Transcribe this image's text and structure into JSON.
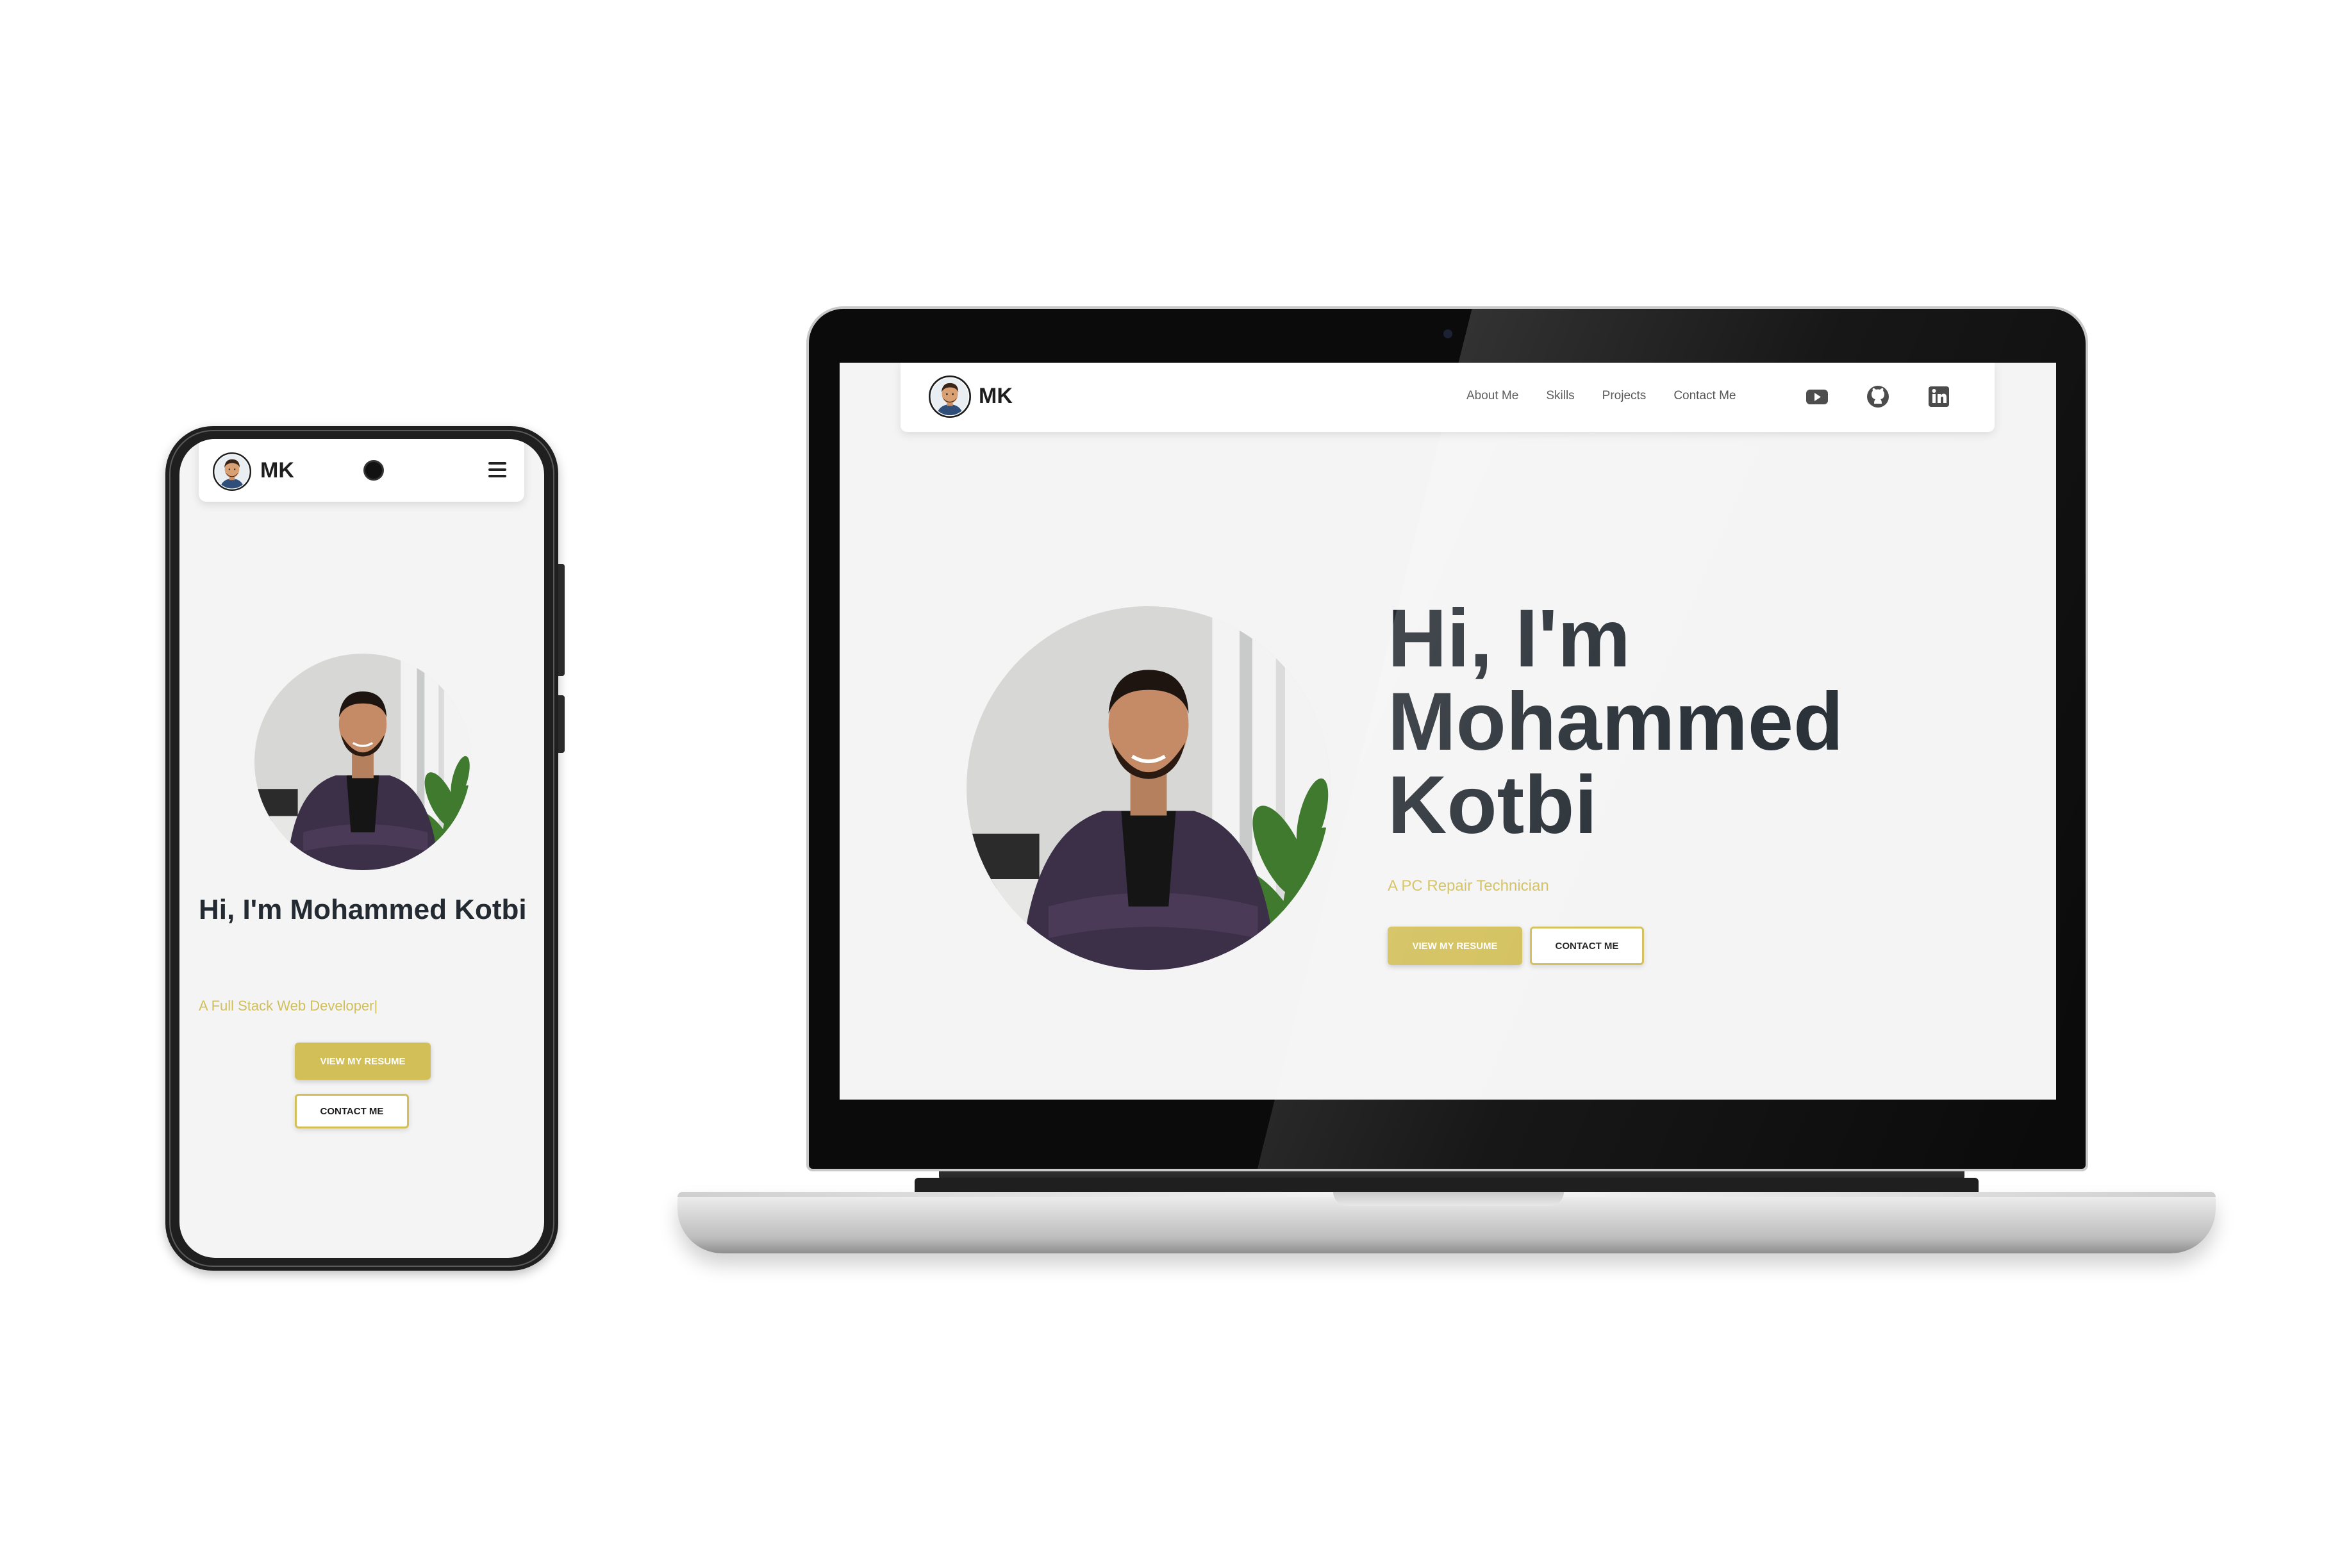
{
  "phone": {
    "logo": "MK",
    "heading": "Hi, I'm Mohammed Kotbi",
    "subtitle": "A Full Stack Web Developer|",
    "resume_btn": "VIEW MY RESUME",
    "contact_btn": "CONTACT ME"
  },
  "laptop": {
    "logo": "MK",
    "nav": [
      "About Me",
      "Skills",
      "Projects",
      "Contact Me"
    ],
    "social_icons": [
      "youtube-icon",
      "github-icon",
      "linkedin-icon"
    ],
    "heading_lines": [
      "Hi, I'm",
      "Mohammed",
      "Kotbi"
    ],
    "subtitle": "A PC Repair Technician",
    "resume_btn": "VIEW MY RESUME",
    "contact_btn": "CONTACT ME"
  },
  "colors": {
    "accent": "#d2bf58",
    "heading": "#232a31",
    "background": "#f4f4f4"
  }
}
